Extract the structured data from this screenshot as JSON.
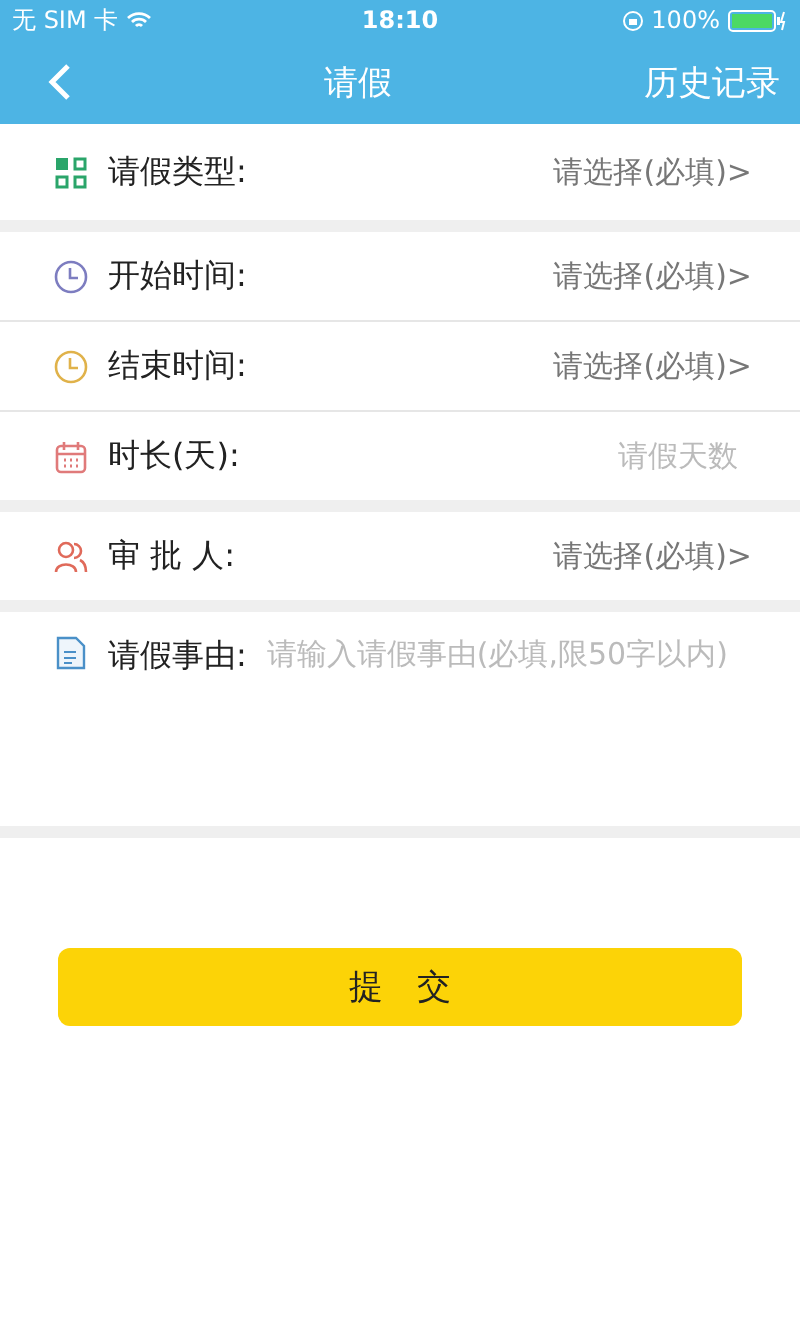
{
  "status_bar": {
    "carrier": "无 SIM 卡",
    "time": "18:10",
    "battery": "100%"
  },
  "nav": {
    "title": "请假",
    "action": "历史记录"
  },
  "groups": [
    {
      "rows": [
        {
          "kind": "select",
          "label": "请假类型:",
          "placeholder": "请选择(必填)>"
        }
      ]
    },
    {
      "rows": [
        {
          "kind": "select",
          "label": "开始时间:",
          "placeholder": "请选择(必填)>"
        },
        {
          "kind": "select",
          "label": "结束时间:",
          "placeholder": "请选择(必填)>"
        },
        {
          "kind": "input",
          "label": "时长(天):",
          "placeholder": "请假天数"
        }
      ]
    },
    {
      "rows": [
        {
          "kind": "select",
          "label": "审 批 人:",
          "placeholder": "请选择(必填)>"
        }
      ]
    },
    {
      "rows": [
        {
          "kind": "textarea",
          "label": "请假事由:",
          "placeholder": "请输入请假事由(必填,限50字以内)"
        }
      ]
    }
  ],
  "submit": "提　交"
}
